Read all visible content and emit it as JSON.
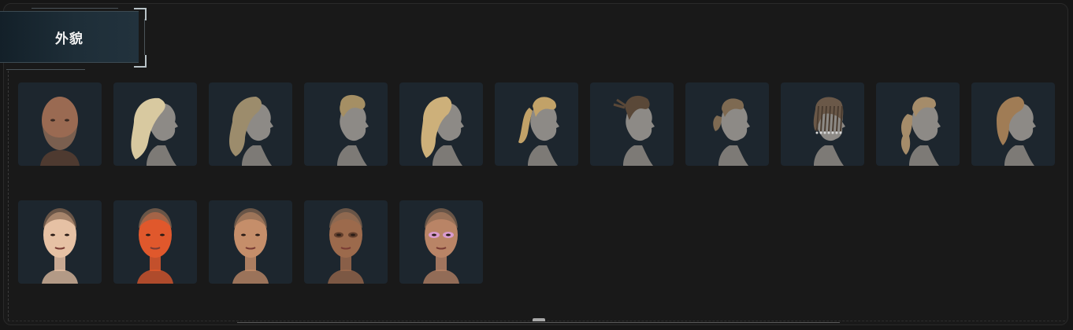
{
  "panel": {
    "title": "外貌"
  },
  "hair_options": [
    {
      "icon": "bald-bearded-male-head-icon",
      "color": "#7a5f4f"
    },
    {
      "icon": "long-wavy-blonde-hair-icon",
      "color": "#d8c9a0"
    },
    {
      "icon": "long-wavy-ash-hair-icon",
      "color": "#9c8c6c"
    },
    {
      "icon": "short-pompadour-hair-icon",
      "color": "#a58f64"
    },
    {
      "icon": "shoulder-length-wavy-blonde-hair-icon",
      "color": "#cdb07a"
    },
    {
      "icon": "ponytail-hair-icon",
      "color": "#c2a268"
    },
    {
      "icon": "cornrow-braids-hair-icon",
      "color": "#5a4838"
    },
    {
      "icon": "slicked-back-bun-hair-icon",
      "color": "#7e6a52"
    },
    {
      "icon": "beaded-braids-hair-icon",
      "color": "#6a5848"
    },
    {
      "icon": "bubble-ponytail-hair-icon",
      "color": "#a58c6a"
    },
    {
      "icon": "bob-cut-hair-icon",
      "color": "#a07c55"
    }
  ],
  "face_options": [
    {
      "icon": "fair-skin-female-face-icon",
      "color": "#e6c1a4"
    },
    {
      "icon": "orange-skin-female-face-icon",
      "color": "#e0582c"
    },
    {
      "icon": "tan-skin-female-face-icon",
      "color": "#c58e6a"
    },
    {
      "icon": "dark-makeup-female-face-icon",
      "color": "#9c6a4c"
    },
    {
      "icon": "pink-makeup-female-face-icon",
      "color": "#b98466"
    }
  ]
}
